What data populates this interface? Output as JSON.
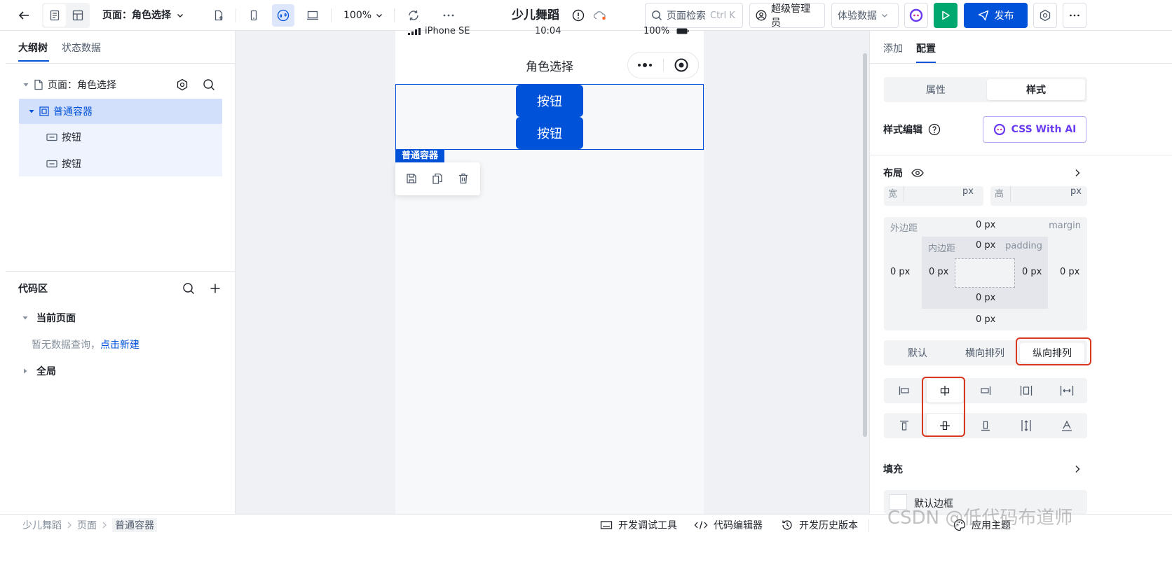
{
  "topbar": {
    "page_selector": "页面：角色选择",
    "zoom": "100%",
    "app_title": "少儿舞蹈",
    "search_label": "页面检索",
    "search_shortcut": "Ctrl K",
    "user_label": "超级管理员",
    "data_env": "体验数据",
    "publish_label": "发布"
  },
  "left": {
    "tabs": [
      "大纲树",
      "状态数据"
    ],
    "tree": {
      "page": "页面：角色选择",
      "container": "普通容器",
      "children": [
        "按钮",
        "按钮"
      ]
    },
    "code": {
      "title": "代码区",
      "current_page": "当前页面",
      "empty_text": "暂无数据查询，",
      "create_link": "点击新建",
      "global": "全局"
    }
  },
  "canvas": {
    "status_carrier": "iPhone SE",
    "status_time": "10:04",
    "status_battery": "100%",
    "nav_title": "角色选择",
    "buttons": [
      "按钮",
      "按钮"
    ],
    "selection_tag": "普通容器"
  },
  "right": {
    "tabs": [
      "添加",
      "配置"
    ],
    "segments": [
      "属性",
      "样式"
    ],
    "style_edit_label": "样式编辑",
    "css_ai_label": "CSS With AI",
    "layout_label": "布局",
    "width_label": "宽",
    "height_label": "高",
    "unit_px": "px",
    "margin_cn": "外边距",
    "margin_en": "margin",
    "padding_cn": "内边距",
    "padding_en": "padding",
    "zero_px": "0 px",
    "direction_options": [
      "默认",
      "横向排列",
      "纵向排列"
    ],
    "fill_label": "填充",
    "border_label": "默认边框"
  },
  "bottom": {
    "breadcrumb": [
      "少儿舞蹈",
      "页面",
      "普通容器"
    ],
    "tools": [
      "开发调试工具",
      "代码编辑器",
      "开发历史版本",
      "应用主题"
    ],
    "watermark": "CSDN @低代码布道师"
  },
  "colors": {
    "primary": "#0052d9",
    "run_green": "#00a870",
    "highlight_red": "#d9381e"
  }
}
